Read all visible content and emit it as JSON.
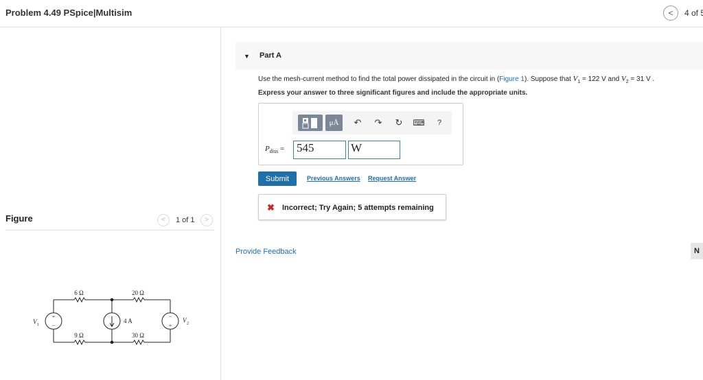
{
  "header": {
    "title": "Problem 4.49 PSpice|Multisim",
    "nav_prev": "<",
    "page_count": "4 of 5"
  },
  "figure_panel": {
    "label": "Figure",
    "nav_prev": "<",
    "count": "1 of 1",
    "nav_next": ">",
    "circuit": {
      "r_top_left": "6 Ω",
      "r_top_right": "20 Ω",
      "r_bottom_left": "9 Ω",
      "r_bottom_right": "30 Ω",
      "current_source": "4 A",
      "v1": "V",
      "v1_sub": "1",
      "v2": "V",
      "v2_sub": "2",
      "plus": "+",
      "minus": "−"
    }
  },
  "part": {
    "caret": "▼",
    "title": "Part A",
    "question_prefix": "Use the mesh-current method to find the total power dissipated in the circuit in (",
    "figure_link": "Figure 1",
    "question_mid": "). Suppose that ",
    "v1_sym": "V",
    "v1_sub": "1",
    "v1_val": " = 122  V and ",
    "v2_sym": "V",
    "v2_sub": "2",
    "v2_val": " = 31  V .",
    "instruction": "Express your answer to three significant figures and include the appropriate units.",
    "toolbar": {
      "units": "μÅ",
      "undo": "↶",
      "redo": "↷",
      "reset": "↻",
      "keyboard": "⌨",
      "help": "?"
    },
    "var_symbol": "P",
    "var_sub": "diss",
    "var_eq": " =",
    "value": "545",
    "unit": "W",
    "submit": "Submit",
    "previous_answers": "Previous Answers",
    "request_answer": "Request Answer",
    "feedback_icon": "✖",
    "feedback": "Incorrect; Try Again; 5 attempts remaining"
  },
  "footer": {
    "provide_feedback": "Provide Feedback",
    "next": "N"
  },
  "colors": {
    "link": "#1a6fb3",
    "submit_bg": "#1f6fa8",
    "error": "#d0271d",
    "toolbar_btn": "#7a8898"
  }
}
